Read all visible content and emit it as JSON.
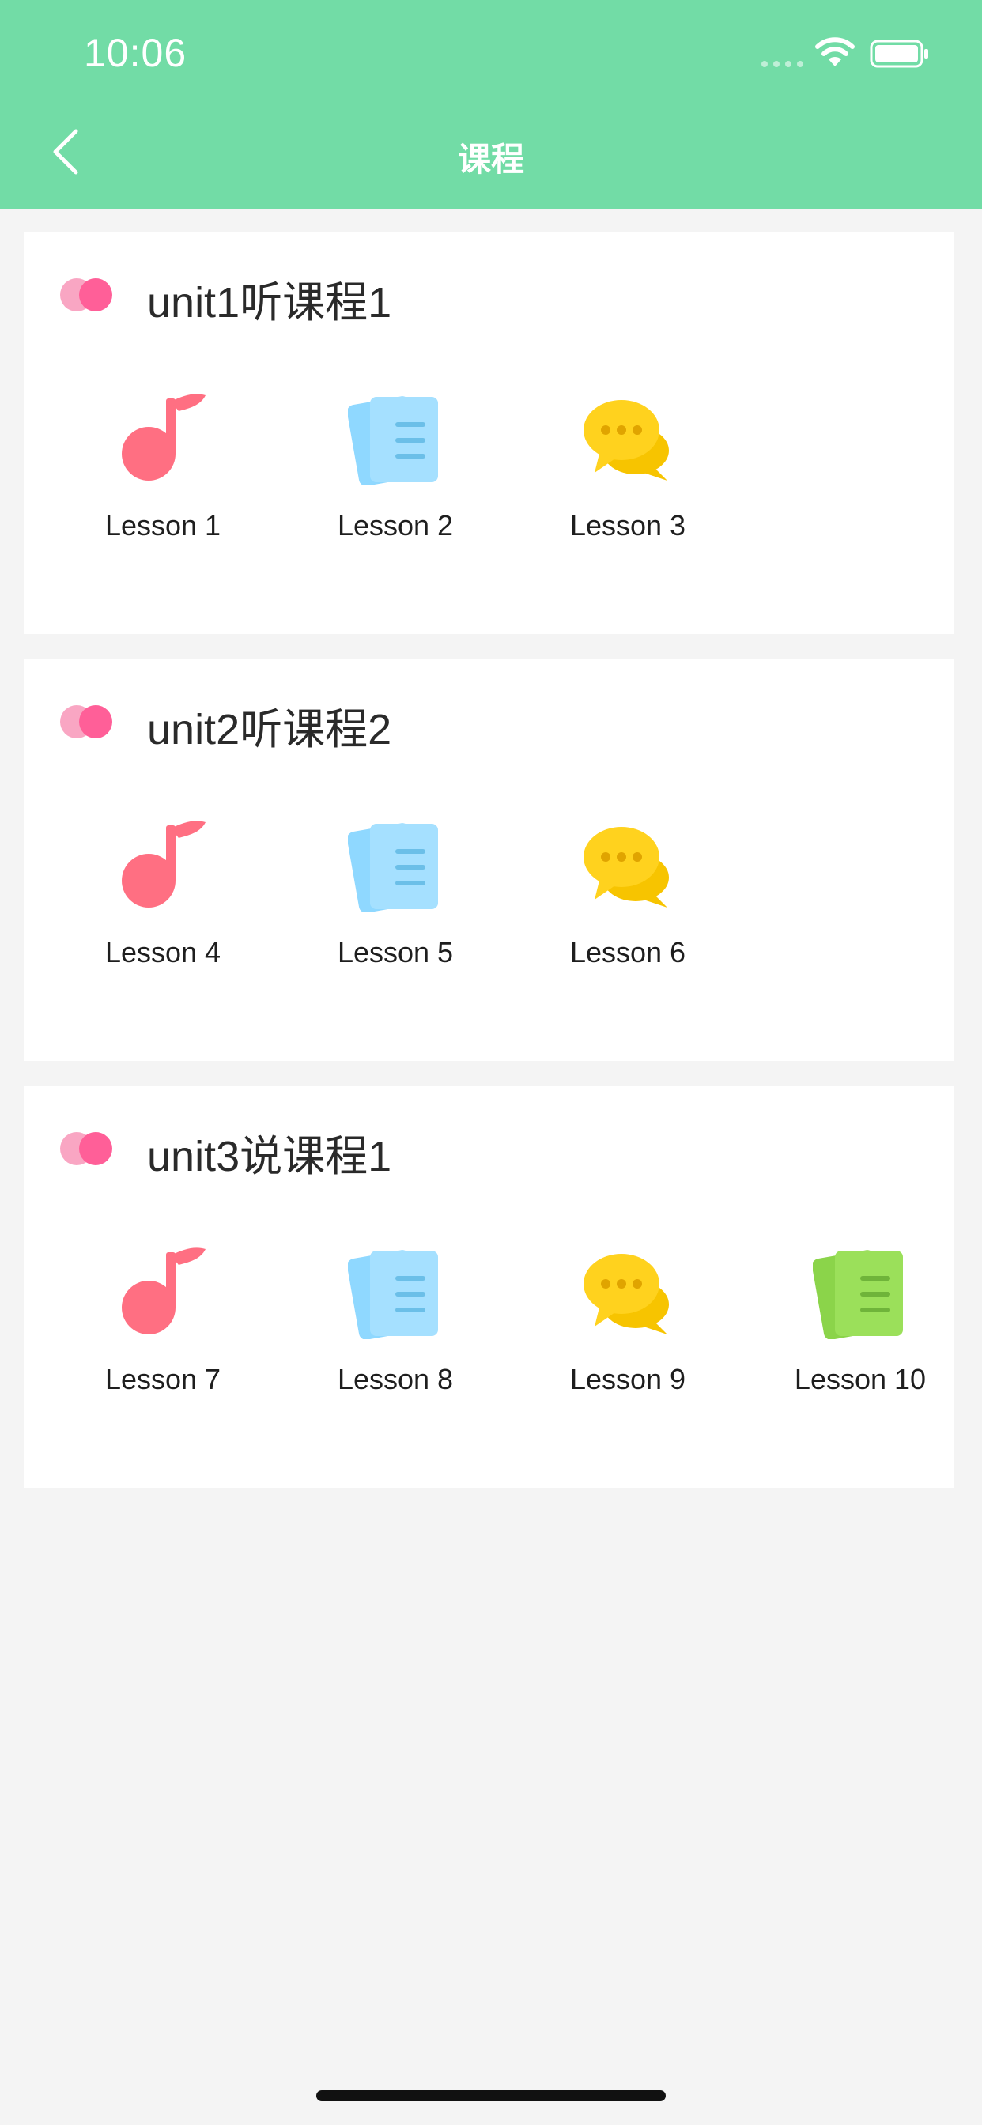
{
  "status_bar": {
    "time": "10:06"
  },
  "nav": {
    "title": "课程"
  },
  "colors": {
    "header": "#72dca6",
    "music": "#ff6f82",
    "doc_blue": "#8fd8ff",
    "chat_yellow": "#ffd21e",
    "doc_green": "#9be05a"
  },
  "units": [
    {
      "title": "unit1听课程1",
      "lessons": [
        {
          "label": "Lesson 1",
          "icon": "music-note-icon"
        },
        {
          "label": "Lesson 2",
          "icon": "document-blue-icon"
        },
        {
          "label": "Lesson 3",
          "icon": "chat-bubbles-icon"
        }
      ]
    },
    {
      "title": "unit2听课程2",
      "lessons": [
        {
          "label": "Lesson 4",
          "icon": "music-note-icon"
        },
        {
          "label": "Lesson 5",
          "icon": "document-blue-icon"
        },
        {
          "label": "Lesson 6",
          "icon": "chat-bubbles-icon"
        }
      ]
    },
    {
      "title": "unit3说课程1",
      "lessons": [
        {
          "label": "Lesson 7",
          "icon": "music-note-icon"
        },
        {
          "label": "Lesson 8",
          "icon": "document-blue-icon"
        },
        {
          "label": "Lesson 9",
          "icon": "chat-bubbles-icon"
        },
        {
          "label": "Lesson 10",
          "icon": "document-green-icon"
        }
      ]
    }
  ]
}
